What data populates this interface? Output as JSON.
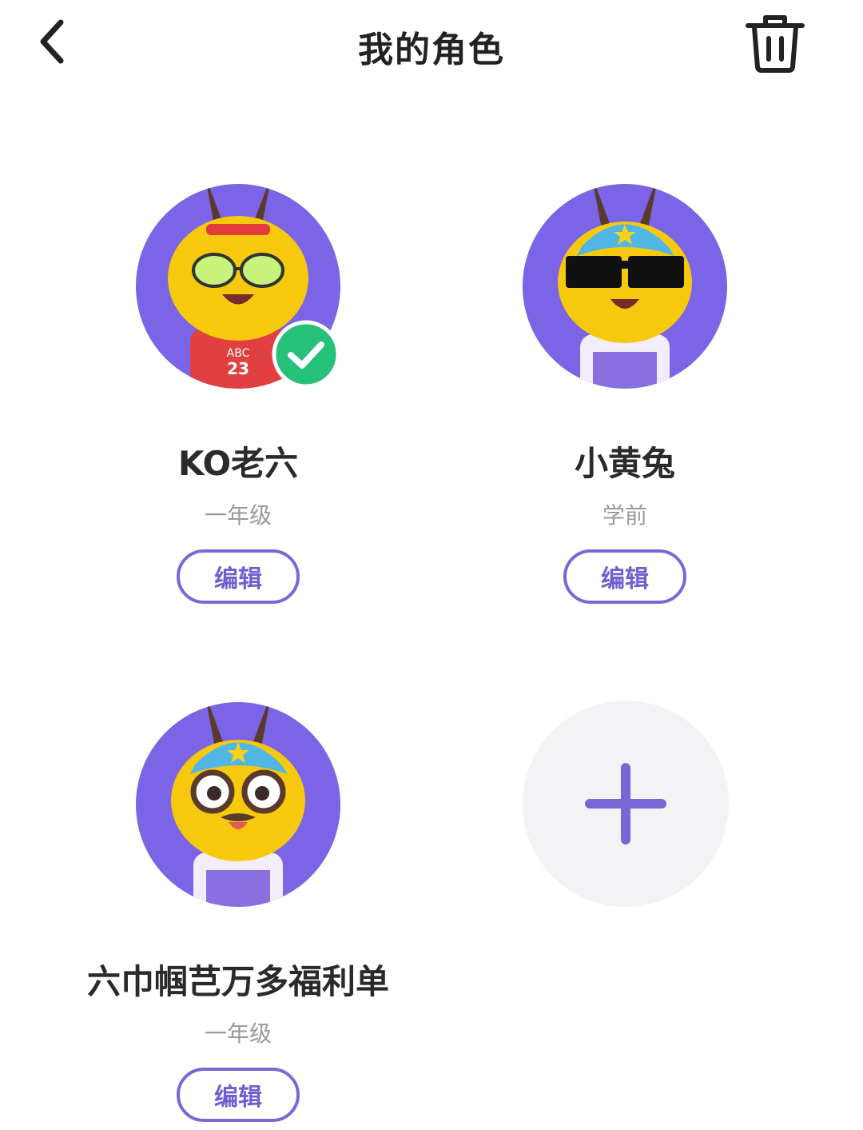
{
  "header": {
    "title": "我的角色",
    "back_icon": "chevron-left-icon",
    "delete_icon": "trash-icon"
  },
  "colors": {
    "accent": "#7a67d6",
    "avatar_bg": "#7b64e6",
    "check_green": "#25c07a",
    "add_bg": "#f3f3f5"
  },
  "roles": [
    {
      "name": "KO老六",
      "grade": "一年级",
      "edit_label": "编辑",
      "selected": true,
      "outfit": "jersey",
      "jersey_text": "ABC",
      "jersey_number": "23"
    },
    {
      "name": "小黄兔",
      "grade": "学前",
      "edit_label": "编辑",
      "selected": false,
      "outfit": "cap-shades"
    },
    {
      "name": "六巾帼芑万多福利单",
      "grade": "一年级",
      "edit_label": "编辑",
      "selected": false,
      "outfit": "cap-glasses"
    }
  ],
  "add_role": {
    "icon": "plus-icon"
  }
}
